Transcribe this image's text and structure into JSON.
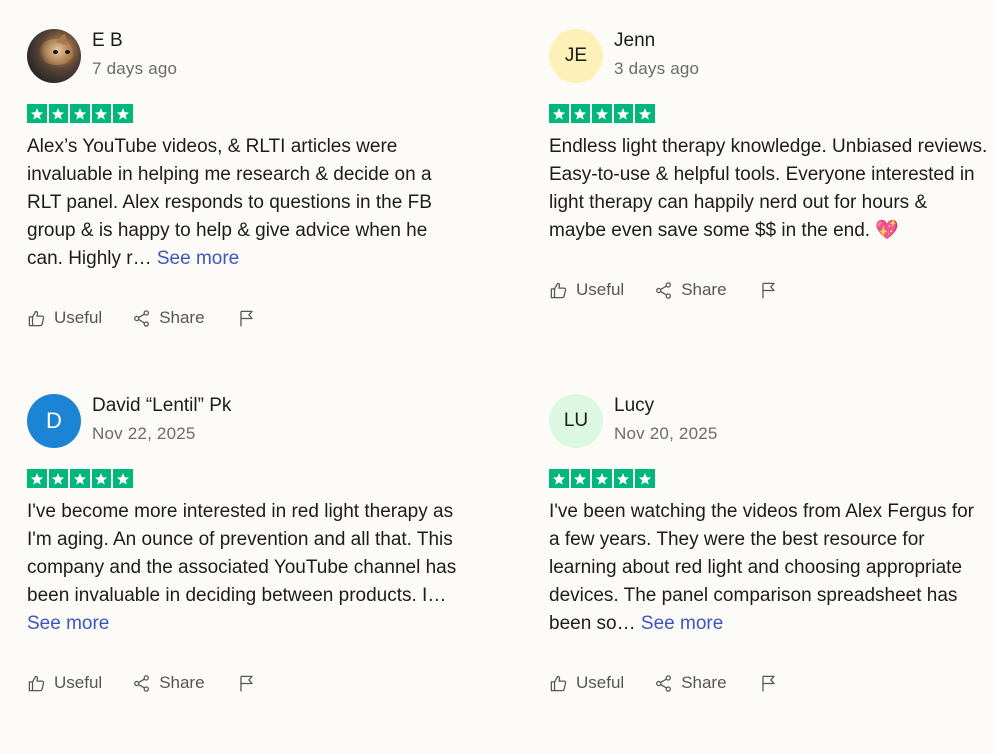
{
  "reviews": [
    {
      "name": "E B",
      "date": "7 days ago",
      "initials": "",
      "avatar_color": "",
      "rating": 5,
      "text": "Alex’s YouTube videos, & RLTI articles were invaluable in helping me research & decide on a RLT panel. Alex responds to questions in the FB group & is happy to help & give advice when he can. Highly r… ",
      "see_more": "See more",
      "actions": {
        "useful": "Useful",
        "share": "Share"
      }
    },
    {
      "name": "Jenn",
      "date": "3 days ago",
      "initials": "JE",
      "avatar_color": "#fdf1b7",
      "rating": 5,
      "text": "Endless light therapy knowledge. Unbiased reviews. Easy-to-use & helpful tools. Everyone interested in light therapy can happily nerd out for hours & maybe even save some $$ in the end. 💖",
      "see_more": "",
      "actions": {
        "useful": "Useful",
        "share": "Share"
      }
    },
    {
      "name": "David “Lentil” Pk",
      "date": "Nov 22, 2025",
      "initials": "D",
      "avatar_color": "#1c84d4",
      "rating": 5,
      "text": "I've become more interested in red light therapy as I'm aging. An ounce of prevention and all that. This company and the associated YouTube channel has been invaluable in deciding between products. I… ",
      "see_more": "See more",
      "actions": {
        "useful": "Useful",
        "share": "Share"
      }
    },
    {
      "name": "Lucy",
      "date": "Nov 20, 2025",
      "initials": "LU",
      "avatar_color": "#dcf7e2",
      "rating": 5,
      "text": "I've been watching the videos from Alex Fergus for a few years. They were the best resource for learning about red light and choosing appropriate devices. The panel comparison spreadsheet has been so… ",
      "see_more": "See more",
      "actions": {
        "useful": "Useful",
        "share": "Share"
      }
    }
  ],
  "colors": {
    "star_green": "#00b67a",
    "link_blue": "#3c57bc"
  },
  "icons": [
    "thumbs-up-icon",
    "share-icon",
    "flag-icon",
    "star-icon"
  ]
}
